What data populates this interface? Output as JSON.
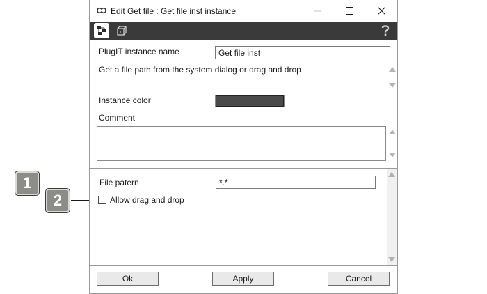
{
  "window": {
    "title": "Edit Get file : Get file inst instance",
    "minimize_icon": "minimize-icon",
    "maximize_icon": "maximize-icon",
    "close_icon": "close-icon"
  },
  "toolbar": {
    "items": [
      {
        "icon": "properties-view-icon",
        "active": true
      },
      {
        "icon": "cube-view-icon",
        "active": false
      }
    ],
    "help_icon": "help-icon"
  },
  "instance": {
    "name_label": "PlugIT instance name",
    "name_value": "Get file inst",
    "description": "Get a file path from the system dialog or drag and drop",
    "color_label": "Instance color",
    "color_value": "#4a4a4a",
    "comment_label": "Comment",
    "comment_value": ""
  },
  "params": {
    "file_pattern_label": "File patern",
    "file_pattern_value": "*.*",
    "allow_drag_drop_label": "Allow drag and drop",
    "allow_drag_drop_checked": false
  },
  "buttons": {
    "ok": "Ok",
    "apply": "Apply",
    "cancel": "Cancel"
  },
  "callouts": [
    {
      "number": "1",
      "target": "File patern"
    },
    {
      "number": "2",
      "target": "Allow drag and drop"
    }
  ]
}
